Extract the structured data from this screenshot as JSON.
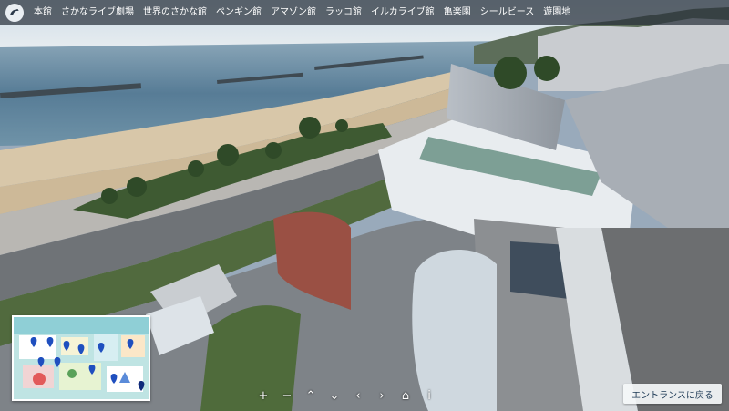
{
  "header": {
    "nav": [
      {
        "label": "本館"
      },
      {
        "label": "さかなライブ劇場"
      },
      {
        "label": "世界のさかな館"
      },
      {
        "label": "ペンギン館"
      },
      {
        "label": "アマゾン館"
      },
      {
        "label": "ラッコ館"
      },
      {
        "label": "イルカライブ館"
      },
      {
        "label": "亀楽園"
      },
      {
        "label": "シールビース"
      },
      {
        "label": "遊園地"
      }
    ]
  },
  "controls": {
    "zoom_in": "+",
    "zoom_out": "−",
    "up": "⌃",
    "down": "⌄",
    "left": "‹",
    "right": "›",
    "home": "⌂",
    "info": "i"
  },
  "entrance_button": {
    "label": "エントランスに戻る"
  },
  "colors": {
    "topbar": "#28303a",
    "minimap_marker": "#1f4fbf"
  }
}
